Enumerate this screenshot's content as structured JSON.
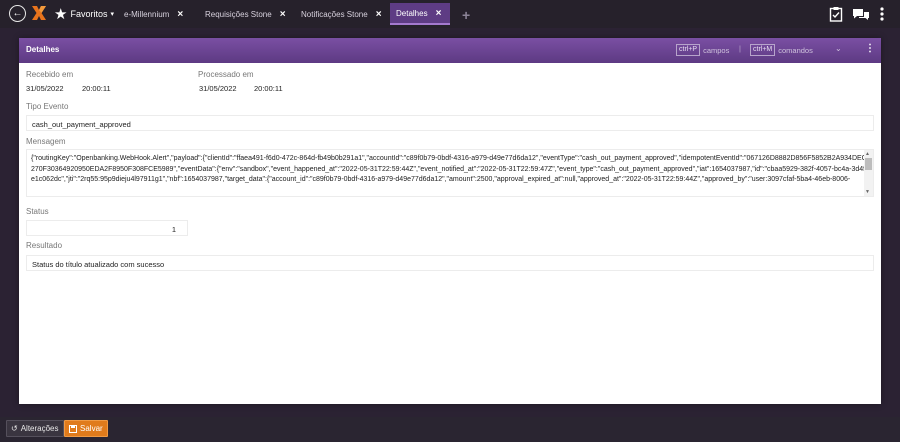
{
  "topbar": {
    "favoritos_label": "Favoritos",
    "tabs": [
      {
        "label": "e-Millennium"
      },
      {
        "label": "Requisições Stone"
      },
      {
        "label": "Notificações Stone"
      },
      {
        "label": "Detalhes"
      }
    ],
    "close_glyph": "×",
    "add_glyph": "+"
  },
  "window": {
    "title": "Detalhes",
    "hint_campos_key": "ctrl+P",
    "hint_campos_label": "campos",
    "hint_sep": "|",
    "hint_comandos_key": "ctrl+M",
    "hint_comandos_label": "comandos"
  },
  "form": {
    "recebido_label": "Recebido em",
    "recebido_date": "31/05/2022",
    "recebido_time": "20:00:11",
    "processado_label": "Processado em",
    "processado_date": "31/05/2022",
    "processado_time": "20:00:11",
    "tipo_label": "Tipo Evento",
    "tipo_value": "cash_out_payment_approved",
    "mensagem_label": "Mensagem",
    "mensagem_value": "{\"routingKey\":\"Openbanking.WebHook.Alert\",\"payload\":{\"clientId\":\"ffaea491-f6d0-472c-864d-fb49b0b291a1\",\"accountId\":\"c89f0b79-0bdf-4316-a979-d49e77d6da12\",\"eventType\":\"cash_out_payment_approved\",\"idempotentEventId\":\"067126D8882D856F5852B2A934DEC270F30364920950EDA2F8950F308FCE5989\",\"eventData\":{\"env\":\"sandbox\",\"event_happened_at\":\"2022-05-31T22:59:44Z\",\"event_notified_at\":\"2022-05-31T22:59:47Z\",\"event_type\":\"cash_out_payment_approved\",\"iat\":1654037987,\"id\":\"cbaa5929-382f-4057-bc4a-3d4fe1c062dc\",\"jti\":\"2rq55:95p9dieju4l97911g1\",\"nbf\":1654037987,\"target_data\":{\"account_id\":\"c89f0b79-0bdf-4316-a979-d49e77d6da12\",\"amount\":2500,\"approval_expired_at\":null,\"approved_at\":\"2022-05-31T22:59:44Z\",\"approved_by\":\"user:3097cfaf-5ba4-46eb-8006-",
    "status_label": "Status",
    "status_value": "1",
    "resultado_label": "Resultado",
    "resultado_value": "Status do título atualizado com sucesso"
  },
  "bottombar": {
    "alteracoes_label": "Alterações",
    "salvar_label": "Salvar"
  },
  "colors": {
    "accent_purple": "#5e3c84",
    "save_orange": "#e07b1c"
  }
}
